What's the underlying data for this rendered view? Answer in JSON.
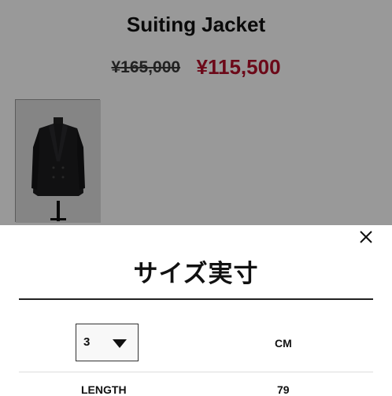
{
  "product": {
    "title": "Suiting Jacket",
    "price_original": "¥165,000",
    "price_sale": "¥115,500",
    "sale_color": "#b5102a"
  },
  "size_sheet": {
    "title": "サイズ実寸",
    "close_icon": "close-icon",
    "selected_size": "3",
    "unit": "CM",
    "rows": [
      {
        "label": "LENGTH",
        "value": "79"
      }
    ]
  }
}
